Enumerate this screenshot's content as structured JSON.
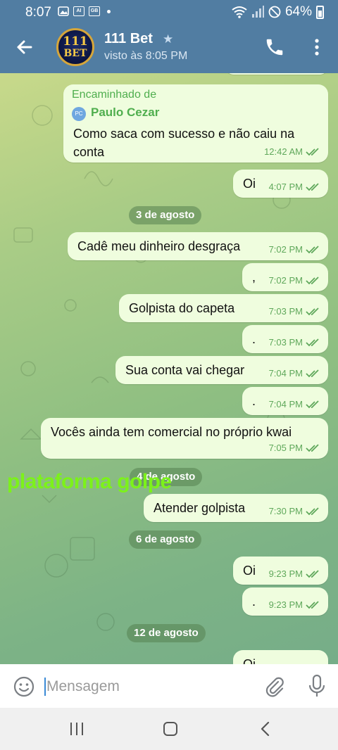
{
  "status_bar": {
    "time": "8:07",
    "battery": "64%",
    "icons": [
      "gallery-icon",
      "ai-badge-icon",
      "ai-badge-icon",
      "wifi-icon",
      "signal-icon",
      "dnd-icon",
      "battery-icon"
    ],
    "badge_1": "AI",
    "badge_2": "GB"
  },
  "header": {
    "title": "111 Bet",
    "subtitle": "visto às 8:05 PM",
    "avatar_text_top": "111",
    "avatar_text_bottom": "BET",
    "icons": [
      "back-arrow-icon",
      "verified-star-icon",
      "phone-icon",
      "more-vert-icon"
    ]
  },
  "forwarded": {
    "label": "Encaminhado de",
    "sender_initials": "PC",
    "sender_name": "Paulo Cezar",
    "line1": "Como saca com sucesso e não caiu na",
    "line2": "conta",
    "time": "12:42 AM"
  },
  "messages": [
    {
      "text": "Oi",
      "time": "4:07 PM"
    },
    {
      "text": "Cadê meu dinheiro desgraça",
      "time": "7:02 PM"
    },
    {
      "text": ",",
      "time": "7:02 PM"
    },
    {
      "text": "Golpista do capeta",
      "time": "7:03 PM"
    },
    {
      "text": ".",
      "time": "7:03 PM"
    },
    {
      "text": "Sua conta vai chegar",
      "time": "7:04 PM"
    },
    {
      "text": ".",
      "time": "7:04 PM"
    },
    {
      "text": "Vocês ainda tem comercial no próprio kwai",
      "time": "7:05 PM"
    },
    {
      "text": "Atender golpista",
      "time": "7:30 PM"
    },
    {
      "text": "Oi",
      "time": "9:23 PM"
    },
    {
      "text": ".",
      "time": "9:23 PM"
    },
    {
      "text": "Oi",
      "time": ""
    }
  ],
  "dates": [
    "3 de agosto",
    "4 de agosto",
    "6 de agosto",
    "12 de agosto"
  ],
  "overlay_text": "plataforma golpe",
  "input": {
    "placeholder": "Mensagem",
    "icons": [
      "emoji-icon",
      "attach-icon",
      "mic-icon"
    ]
  },
  "colors": {
    "header": "#517da2",
    "bubble": "#effdde",
    "tick": "#5fa85b",
    "overlay": "#7cf21a"
  }
}
